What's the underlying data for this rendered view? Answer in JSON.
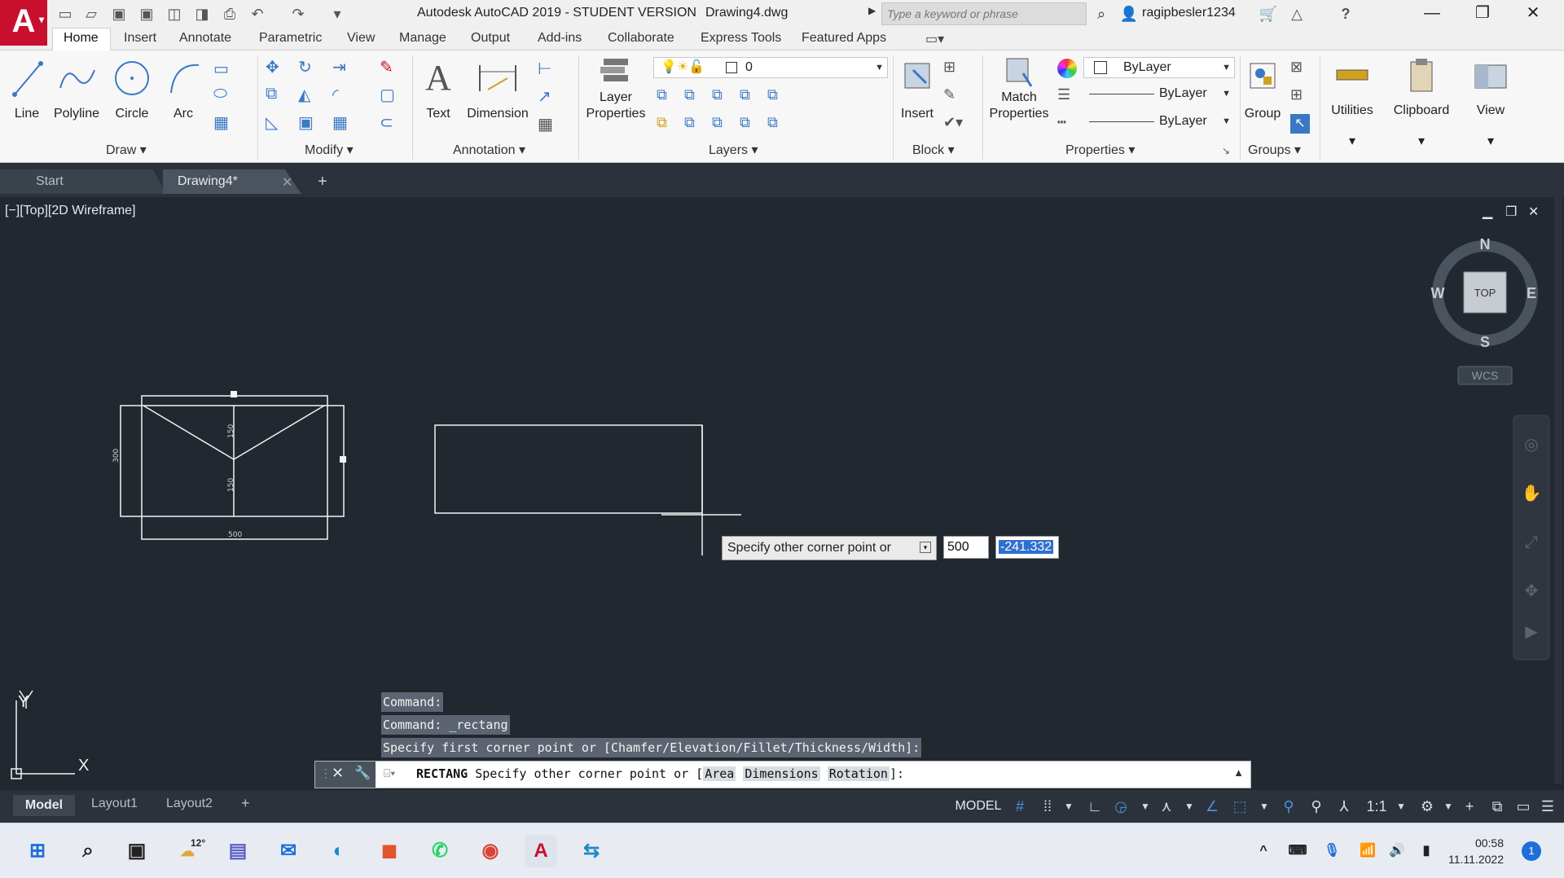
{
  "title_bar": {
    "app_title": "Autodesk AutoCAD 2019 - STUDENT VERSION",
    "file_name": "Drawing4.dwg",
    "search_placeholder": "Type a keyword or phrase",
    "user": "ragipbesler1234"
  },
  "ribbon_tabs": [
    "Home",
    "Insert",
    "Annotate",
    "Parametric",
    "View",
    "Manage",
    "Output",
    "Add-ins",
    "Collaborate",
    "Express Tools",
    "Featured Apps"
  ],
  "ribbon": {
    "draw": {
      "label": "Draw",
      "line": "Line",
      "polyline": "Polyline",
      "circle": "Circle",
      "arc": "Arc"
    },
    "modify": {
      "label": "Modify"
    },
    "annotation": {
      "label": "Annotation",
      "text": "Text",
      "dimension": "Dimension"
    },
    "layers": {
      "label": "Layers",
      "layer_properties_1": "Layer",
      "layer_properties_2": "Properties",
      "current_layer": "0"
    },
    "block": {
      "label": "Block",
      "insert": "Insert"
    },
    "properties": {
      "label": "Properties",
      "match_1": "Match",
      "match_2": "Properties",
      "color": "ByLayer",
      "linetype": "ByLayer",
      "lineweight": "ByLayer"
    },
    "groups": {
      "label": "Groups",
      "group": "Group"
    },
    "utilities": "Utilities",
    "clipboard": "Clipboard",
    "view": "View"
  },
  "doc_tabs": {
    "start": "Start",
    "drawing": "Drawing4*"
  },
  "viewport": {
    "label": "[−][Top][2D Wireframe]",
    "compass": {
      "n": "N",
      "s": "S",
      "e": "E",
      "w": "W",
      "top": "TOP",
      "ucs": "WCS"
    },
    "dim_labels": {
      "height_left": "300",
      "upper_mid": "150",
      "lower_mid": "150",
      "bottom": "500"
    },
    "axis_x": "X",
    "axis_y": "Y"
  },
  "dynamic_input": {
    "prompt": "Specify other corner point or",
    "value1": "500",
    "value2": "-241.332"
  },
  "command_history": [
    "Command:",
    "Command: _rectang",
    "Specify first corner point or [Chamfer/Elevation/Fillet/Thickness/Width]:"
  ],
  "command_line": {
    "command": "RECTANG",
    "prompt": "Specify other corner point or [",
    "options": [
      "Area",
      "Dimensions",
      "Rotation"
    ],
    "suffix": "]:"
  },
  "layout_tabs": [
    "Model",
    "Layout1",
    "Layout2"
  ],
  "status_bar": {
    "model": "MODEL",
    "scale": "1:1"
  },
  "taskbar": {
    "weather": "12°",
    "time": "00:58",
    "date": "11.11.2022",
    "notification_count": "1"
  },
  "colors": {
    "canvas_bg": "#212830",
    "autocad_red": "#c8102e",
    "accent_blue": "#2f6fcf"
  }
}
